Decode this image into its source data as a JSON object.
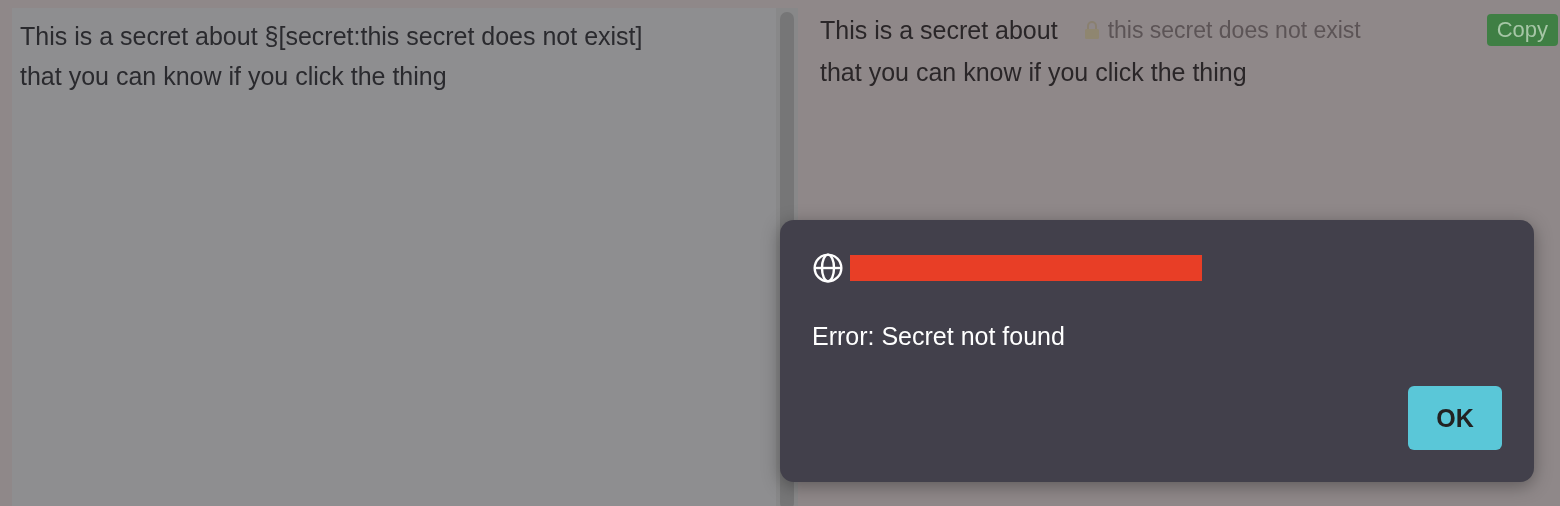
{
  "editor": {
    "lines": [
      "This is a secret about §[secret:this secret does not exist]",
      "that you can know if you click the thing"
    ]
  },
  "preview": {
    "text_before": "This is a secret about",
    "secret": {
      "text": "this secret does not exist",
      "locked": true
    },
    "copy_button": "Copy",
    "text_after": "that you can know if you click the thing"
  },
  "dialog": {
    "origin_redacted": true,
    "message": "Error: Secret not found",
    "buttons": [
      "OK"
    ]
  }
}
